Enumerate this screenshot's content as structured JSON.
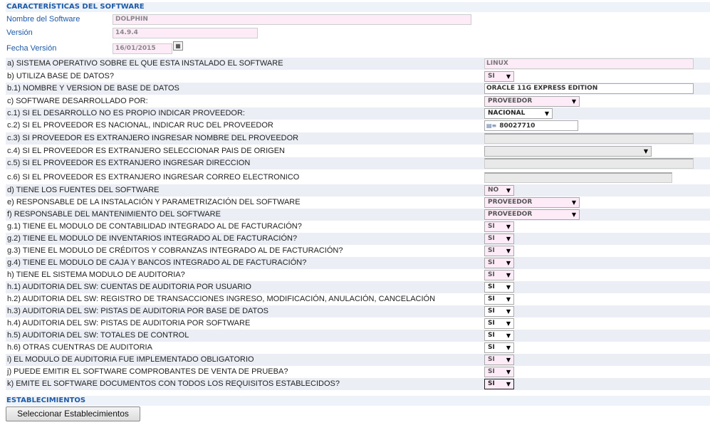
{
  "section_title": "CARACTERÍSTICAS DEL SOFTWARE",
  "software": {
    "name_label": "Nombre del Software",
    "name_value": "DOLPHIN",
    "version_label": "Versión",
    "version_value": "14.9.4",
    "date_label": "Fecha Versión",
    "date_value": "16/01/2015"
  },
  "questions": [
    {
      "label": "a) SISTEMA OPERATIVO SOBRE EL QUE ESTA INSTALADO EL SOFTWARE",
      "control": "text-pink",
      "value": "LINUX"
    },
    {
      "label": "b) UTILIZA BASE DE DATOS?",
      "control": "select",
      "value": "SI"
    },
    {
      "label": "b.1) NOMBRE Y VERSION DE BASE DE DATOS",
      "control": "text",
      "value": "ORACLE 11G EXPRESS EDITION"
    },
    {
      "label": "c) SOFTWARE DESARROLLADO POR:",
      "control": "select-wide",
      "value": "PROVEEDOR"
    },
    {
      "label": "c.1) SI EL DESARROLLO NO ES PROPIO INDICAR PROVEEDOR:",
      "control": "select-mid-white",
      "value": "NACIONAL"
    },
    {
      "label": "c.2) SI EL PROVEEDOR ES NACIONAL, INDICAR RUC DEL PROVEEDOR",
      "control": "ruc",
      "value": "80027710"
    },
    {
      "label": "c.3) SI PROVEEDOR ES EXTRANJERO INGRESAR NOMBRE DEL PROVEEDOR",
      "control": "text-gray",
      "value": ""
    },
    {
      "label": "c.4) SI EL PROVEEDOR ES EXTRANJERO SELECCIONAR PAIS DE ORIGEN",
      "control": "select-country",
      "value": ""
    },
    {
      "label": "c.5) SI EL PROVEEDOR ES EXTRANJERO INGRESAR DIRECCION",
      "control": "text-gray",
      "value": ""
    },
    {
      "label": "c.6) SI EL PROVEEDOR ES EXTRANJERO INGRESAR CORREO ELECTRONICO",
      "control": "text-gray-short",
      "value": ""
    },
    {
      "label": "d) TIENE LOS FUENTES DEL SOFTWARE",
      "control": "select",
      "value": "NO"
    },
    {
      "label": "e) RESPONSABLE DE LA INSTALACIÓN Y PARAMETRIZACIÓN DEL SOFTWARE",
      "control": "select-wide",
      "value": "PROVEEDOR"
    },
    {
      "label": "f) RESPONSABLE DEL MANTENIMIENTO DEL SOFTWARE",
      "control": "select-wide",
      "value": "PROVEEDOR"
    },
    {
      "label": "g.1) TIENE EL MODULO DE CONTABILIDAD INTEGRADO AL DE FACTURACIÓN?",
      "control": "select",
      "value": "SI"
    },
    {
      "label": "g.2) TIENE EL MODULO DE INVENTARIOS INTEGRADO AL DE FACTURACIÓN?",
      "control": "select",
      "value": "SI"
    },
    {
      "label": "g.3) TIENE EL MODULO DE CRÉDITOS Y COBRANZAS INTEGRADO AL DE FACTURACIÓN?",
      "control": "select",
      "value": "SI"
    },
    {
      "label": "g.4) TIENE EL MODULO DE CAJA Y BANCOS INTEGRADO AL DE FACTURACIÓN?",
      "control": "select",
      "value": "SI"
    },
    {
      "label": "h) TIENE EL SISTEMA MODULO DE AUDITORIA?",
      "control": "select",
      "value": "SI"
    },
    {
      "label": "h.1) AUDITORIA DEL SW: CUENTAS DE AUDITORIA POR USUARIO",
      "control": "select-white",
      "value": "SI"
    },
    {
      "label": "h.2) AUDITORIA DEL SW: REGISTRO DE TRANSACCIONES INGRESO, MODIFICACIÓN, ANULACIÓN, CANCELACIÓN",
      "control": "select-white",
      "value": "SI"
    },
    {
      "label": "h.3) AUDITORIA DEL SW: PISTAS DE AUDITORIA POR BASE DE DATOS",
      "control": "select-white",
      "value": "SI"
    },
    {
      "label": "h.4) AUDITORIA DEL SW: PISTAS DE AUDITORIA POR SOFTWARE",
      "control": "select-white",
      "value": "SI"
    },
    {
      "label": "h.5) AUDITORIA DEL SW: TOTALES DE CONTROL",
      "control": "select-white",
      "value": "SI"
    },
    {
      "label": "h.6) OTRAS CUENTRAS DE AUDITORIA",
      "control": "select-white",
      "value": "SI"
    },
    {
      "label": "i) EL MODULO DE AUDITORIA FUE IMPLEMENTADO OBLIGATORIO",
      "control": "select",
      "value": "SI"
    },
    {
      "label": "j) PUEDE EMITIR EL SOFTWARE COMPROBANTES DE VENTA DE PRUEBA?",
      "control": "select",
      "value": "SI"
    },
    {
      "label": "k) EMITE EL SOFTWARE DOCUMENTOS CON TODOS LOS REQUISITOS ESTABLECIDOS?",
      "control": "select-focus",
      "value": "SI"
    }
  ],
  "establecimientos_title": "ESTABLECIMIENTOS",
  "button_label": "Seleccionar Establecimientos",
  "icons": {
    "calendar": "calendar-icon",
    "dropdown": "chevron-down-icon",
    "ruc": "id-card-icon"
  },
  "colors": {
    "section_text": "#1f5aa6",
    "section_bg": "#eef3f9",
    "pink_field": "#fdebf8",
    "odd_row": "#ebeff5"
  }
}
